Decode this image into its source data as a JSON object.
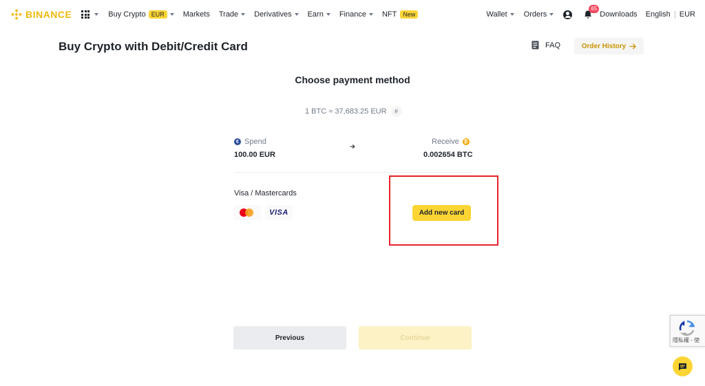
{
  "nav": {
    "brand": "BINANCE",
    "items": [
      {
        "label": "Buy Crypto",
        "badge": "EUR",
        "caret": true
      },
      {
        "label": "Markets",
        "caret": false
      },
      {
        "label": "Trade",
        "caret": true
      },
      {
        "label": "Derivatives",
        "caret": true
      },
      {
        "label": "Earn",
        "caret": true
      },
      {
        "label": "Finance",
        "caret": true
      },
      {
        "label": "NFT",
        "badge": "New",
        "caret": false
      }
    ],
    "right": {
      "wallet": "Wallet",
      "orders": "Orders",
      "notification_count": "65",
      "downloads": "Downloads",
      "language": "English",
      "currency": "EUR"
    }
  },
  "header": {
    "title": "Buy Crypto with Debit/Credit Card",
    "faq": "FAQ",
    "order_history": "Order History"
  },
  "main": {
    "section_title": "Choose payment method",
    "rate": "1 BTC ≈ 37,683.25 EUR",
    "rate_icon": "#",
    "spend_label": "Spend",
    "spend_value": "100.00 EUR",
    "receive_label": "Receive",
    "receive_value": "0.002654 BTC",
    "card_section_label": "Visa / Mastercards",
    "visa_text": "VISA",
    "add_card_label": "Add new card",
    "previous_label": "Previous",
    "continue_label": "Continue"
  },
  "recaptcha": {
    "text": "隱私權 - 使"
  },
  "colors": {
    "brand": "#f0b90b",
    "primary_button": "#fcd535",
    "highlight": "#e8202a"
  }
}
